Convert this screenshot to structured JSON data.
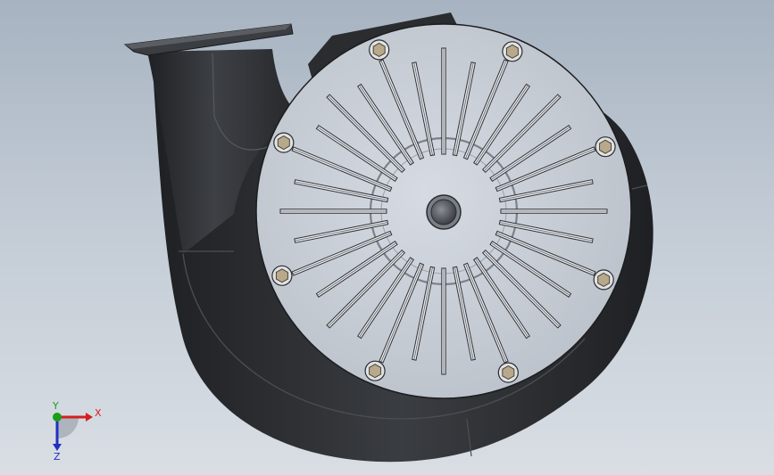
{
  "viewport": {
    "background_top": "#a7b3c1",
    "background_bottom": "#d9dee4"
  },
  "model": {
    "housing_color": "#2b2d30",
    "housing_highlight": "#4a4d52",
    "cover_color": "#c9ced6",
    "slot_count": 32,
    "bolt_count": 8,
    "shaft_color": "#5e6268"
  },
  "triad": {
    "x_label": "X",
    "y_label": "Y",
    "z_label": "Z",
    "x_color": "#d32020",
    "y_color": "#18a018",
    "z_color": "#2030c0"
  }
}
